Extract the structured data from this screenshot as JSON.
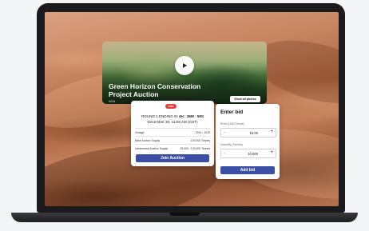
{
  "hero": {
    "title_line1": "Green Horizon Conservation",
    "title_line2": "Project Auction",
    "subtitle": "ACA",
    "show_photos_label": "Show all photos"
  },
  "auction": {
    "live_badge": "Live",
    "round_prefix": "ROUND 1 ENDING IN",
    "round_time": "4H : 36M : 59S",
    "date": "December 30, 11:09 AM (GST)",
    "rows": [
      {
        "label": "Vintage",
        "value": "2019 - 2019"
      },
      {
        "label": "Base Auction Supply",
        "value": "100,000 Tonnes"
      },
      {
        "label": "Incremental Auction Supply",
        "value": "25,000 - 100,000 Tonnes"
      }
    ],
    "join_label": "Join Auction"
  },
  "bid": {
    "title": "Enter bid",
    "price_label": "Price (USD/Tonne)",
    "price_value": "15.00",
    "quantity_label": "Quantity (Tonnes)",
    "quantity_value": "10,000",
    "minus_symbol": "–",
    "plus_symbol": "+",
    "add_label": "Add bid"
  },
  "colors": {
    "accent": "#3a4fa5",
    "live": "#e0403a"
  }
}
